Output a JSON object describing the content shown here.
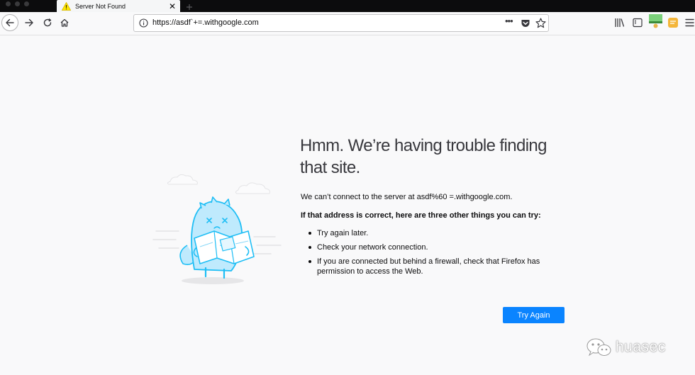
{
  "tab": {
    "title": "Server Not Found",
    "close": "✕"
  },
  "urlbar": {
    "url": "https://asdf`+=.withgoogle.com",
    "more": "•••"
  },
  "error": {
    "title": "Hmm. We’re having trouble finding that site.",
    "description": "We can’t connect to the server at asdf%60 =.withgoogle.com.",
    "lead": "If that address is correct, here are three other things you can try:",
    "suggestions": [
      "Try again later.",
      "Check your network connection.",
      "If you are connected but behind a firewall, check that Firefox has permission to access the Web."
    ],
    "button": "Try Again"
  },
  "watermark": {
    "text": "huasec"
  },
  "colors": {
    "primary_button": "#0a84ff",
    "page_background": "#f9f9fa",
    "tabstrip": "#0c0c0d",
    "illustration_stroke": "#1ebef5"
  },
  "icons": [
    "warning-icon",
    "back-arrow-icon",
    "forward-arrow-icon",
    "reload-icon",
    "home-icon",
    "info-icon",
    "pocket-icon",
    "star-icon",
    "library-icon",
    "sidebar-icon",
    "extension-icon",
    "hamburger-menu-icon",
    "wechat-icon"
  ]
}
